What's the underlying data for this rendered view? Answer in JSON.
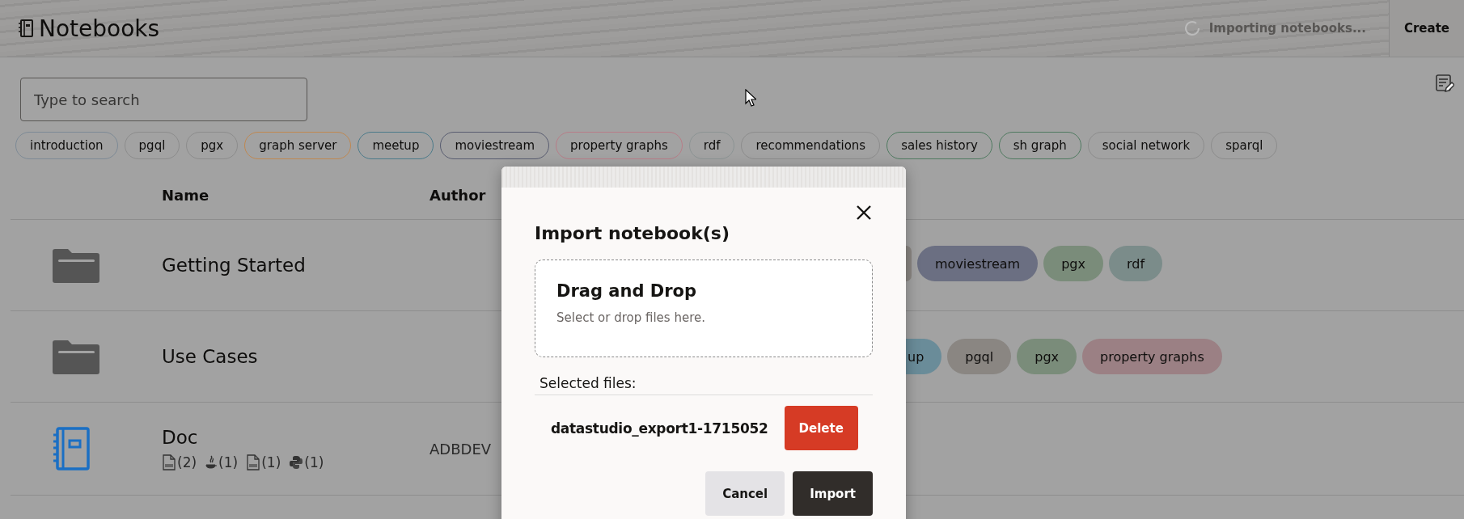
{
  "header": {
    "title": "Notebooks",
    "status": "Importing notebooks...",
    "create_button": "Create"
  },
  "search": {
    "placeholder": "Type to search"
  },
  "tag_filters": [
    {
      "label": "introduction",
      "color": "#7d8a96"
    },
    {
      "label": "pgql",
      "color": "#8c8c8c"
    },
    {
      "label": "pgx",
      "color": "#8c8c8c"
    },
    {
      "label": "graph server",
      "color": "#c08850"
    },
    {
      "label": "meetup",
      "color": "#4a7a8a"
    },
    {
      "label": "moviestream",
      "color": "#585c70"
    },
    {
      "label": "property graphs",
      "color": "#b87d88"
    },
    {
      "label": "rdf",
      "color": "#8c9494"
    },
    {
      "label": "recommendations",
      "color": "#8c8c8c"
    },
    {
      "label": "sales history",
      "color": "#4f7a60"
    },
    {
      "label": "sh graph",
      "color": "#4f7a60"
    },
    {
      "label": "social network",
      "color": "#8c8c8c"
    },
    {
      "label": "sparql",
      "color": "#8c8c8c"
    }
  ],
  "table": {
    "columns": [
      "Name",
      "Author"
    ],
    "rows": [
      {
        "kind": "folder",
        "name": "Getting Started",
        "tags": [
          {
            "color": "#8a8682"
          },
          {
            "label": "moviestream",
            "color": "#6b6f82"
          },
          {
            "label": "pgx",
            "color": "#7a8c7a"
          },
          {
            "label": "rdf",
            "color": "#7b8c8a"
          }
        ]
      },
      {
        "kind": "folder",
        "name": "Use Cases",
        "tags": [
          {
            "label": "up",
            "color": "#6a8c99"
          },
          {
            "label": "pgql",
            "color": "#8a8682"
          },
          {
            "label": "pgx",
            "color": "#7a8c7a"
          },
          {
            "label": "property graphs",
            "color": "#9b8084"
          }
        ]
      },
      {
        "kind": "notebook",
        "name": "Doc",
        "author": "ADBDEV",
        "counts": [
          {
            "kind": "sql",
            "count": "(2)"
          },
          {
            "kind": "java",
            "count": "(1)"
          },
          {
            "kind": "pgql",
            "count": "(1)"
          },
          {
            "kind": "python",
            "count": "(1)"
          }
        ]
      }
    ]
  },
  "dialog": {
    "title": "Import notebook(s)",
    "dropzone_title": "Drag and Drop",
    "dropzone_hint": "Select or drop files here.",
    "selected_label": "Selected files:",
    "files": [
      {
        "name": "datastudio_export1-1715052",
        "action": "Delete"
      }
    ],
    "buttons": [
      {
        "label": "Cancel",
        "kind": "secondary"
      },
      {
        "label": "Import",
        "kind": "primary"
      }
    ]
  }
}
